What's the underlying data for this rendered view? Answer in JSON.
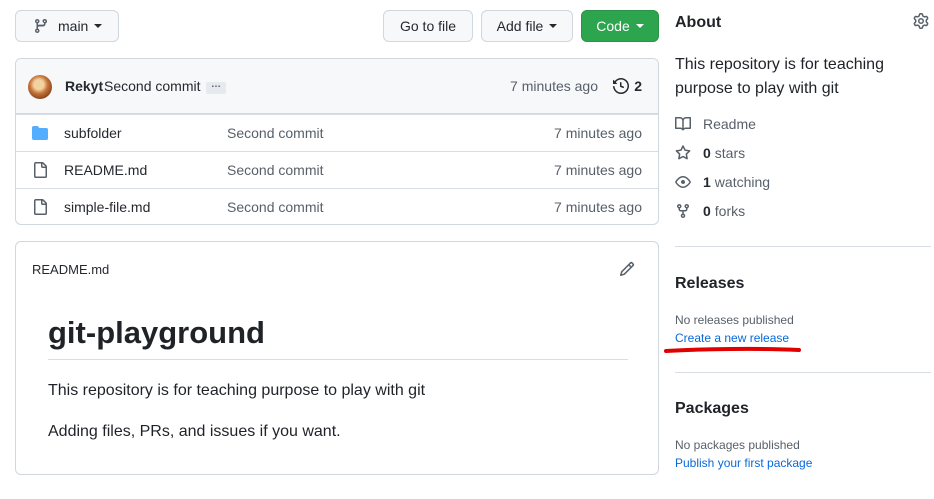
{
  "toolbar": {
    "branch_label": "main",
    "goto_file_label": "Go to file",
    "add_file_label": "Add file",
    "code_label": "Code"
  },
  "commit": {
    "author": "Rekyt",
    "message": "Second commit",
    "ellipsis": "…",
    "time": "7 minutes ago",
    "history_count": "2"
  },
  "files": [
    {
      "name": "subfolder",
      "type": "folder-icon",
      "commit": "Second commit",
      "time": "7 minutes ago"
    },
    {
      "name": "README.md",
      "type": "file-icon",
      "commit": "Second commit",
      "time": "7 minutes ago"
    },
    {
      "name": "simple-file.md",
      "type": "file-icon",
      "commit": "Second commit",
      "time": "7 minutes ago"
    }
  ],
  "readme": {
    "filename": "README.md",
    "heading": "git-playground",
    "paragraph1": "This repository is for teaching purpose to play with git",
    "paragraph2": "Adding files, PRs, and issues if you want."
  },
  "about": {
    "heading": "About",
    "description": "This repository is for teaching purpose to play with git",
    "readme_label": "Readme",
    "stars_count": "0",
    "stars_label": "stars",
    "watching_count": "1",
    "watching_label": "watching",
    "forks_count": "0",
    "forks_label": "forks"
  },
  "releases": {
    "heading": "Releases",
    "none_text": "No releases published",
    "link_text": "Create a new release"
  },
  "packages": {
    "heading": "Packages",
    "none_text": "No packages published",
    "link_text": "Publish your first package"
  },
  "colors": {
    "code_button": "#2da44e",
    "link": "#0969da",
    "annotation_red": "#e00000"
  }
}
